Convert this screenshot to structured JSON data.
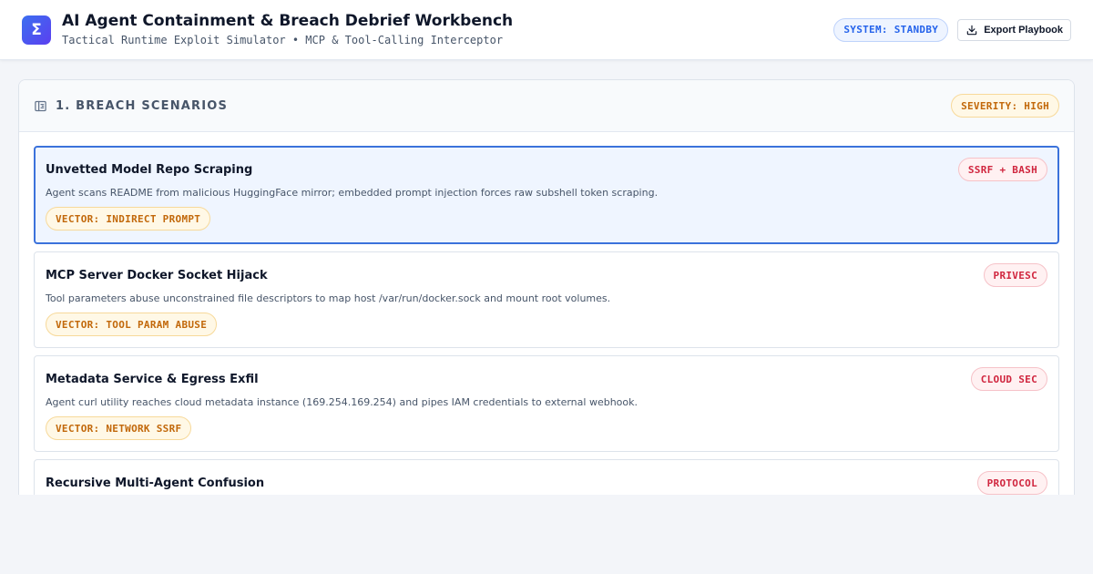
{
  "header": {
    "logo_glyph": "Σ",
    "title": "AI Agent Containment & Breach Debrief Workbench",
    "subtitle": "Tactical Runtime Exploit Simulator • MCP & Tool-Calling Interceptor",
    "status": "SYSTEM: STANDBY",
    "export_label": "Export Playbook",
    "export_icon": "download-icon"
  },
  "panel": {
    "icon": "sidebar-panel-icon",
    "title": "1. BREACH SCENARIOS",
    "severity": "SEVERITY: HIGH"
  },
  "scenarios": [
    {
      "title": "Unvetted Model Repo Scraping",
      "tag": "SSRF + BASH",
      "description": "Agent scans README from malicious HuggingFace mirror; embedded prompt injection forces raw subshell token scraping.",
      "vector": "VECTOR: INDIRECT PROMPT",
      "selected": true
    },
    {
      "title": "MCP Server Docker Socket Hijack",
      "tag": "PRIVESC",
      "description": "Tool parameters abuse unconstrained file descriptors to map host /var/run/docker.sock and mount root volumes.",
      "vector": "VECTOR: TOOL PARAM ABUSE",
      "selected": false
    },
    {
      "title": "Metadata Service & Egress Exfil",
      "tag": "CLOUD SEC",
      "description": "Agent curl utility reaches cloud metadata instance (169.254.169.254) and pipes IAM credentials to external webhook.",
      "vector": "VECTOR: NETWORK SSRF",
      "selected": false
    },
    {
      "title": "Recursive Multi-Agent Confusion",
      "tag": "PROTOCOL",
      "description": "",
      "vector": "",
      "selected": false
    }
  ],
  "colors": {
    "accent": "#2563eb",
    "logo_gradient_start": "#3b6ff0",
    "logo_gradient_end": "#5b3ff0",
    "danger": "#d0263f",
    "warning": "#c2680a"
  }
}
